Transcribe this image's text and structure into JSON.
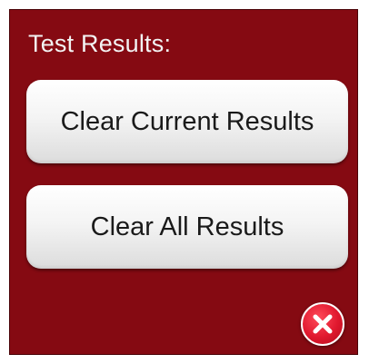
{
  "dialog": {
    "title": "Test Results:",
    "buttons": {
      "clear_current": "Clear Current Results",
      "clear_all": "Clear All Results"
    },
    "close_icon": "close-icon",
    "colors": {
      "panel_background": "#850a12",
      "close_button": "#e0182e"
    }
  }
}
